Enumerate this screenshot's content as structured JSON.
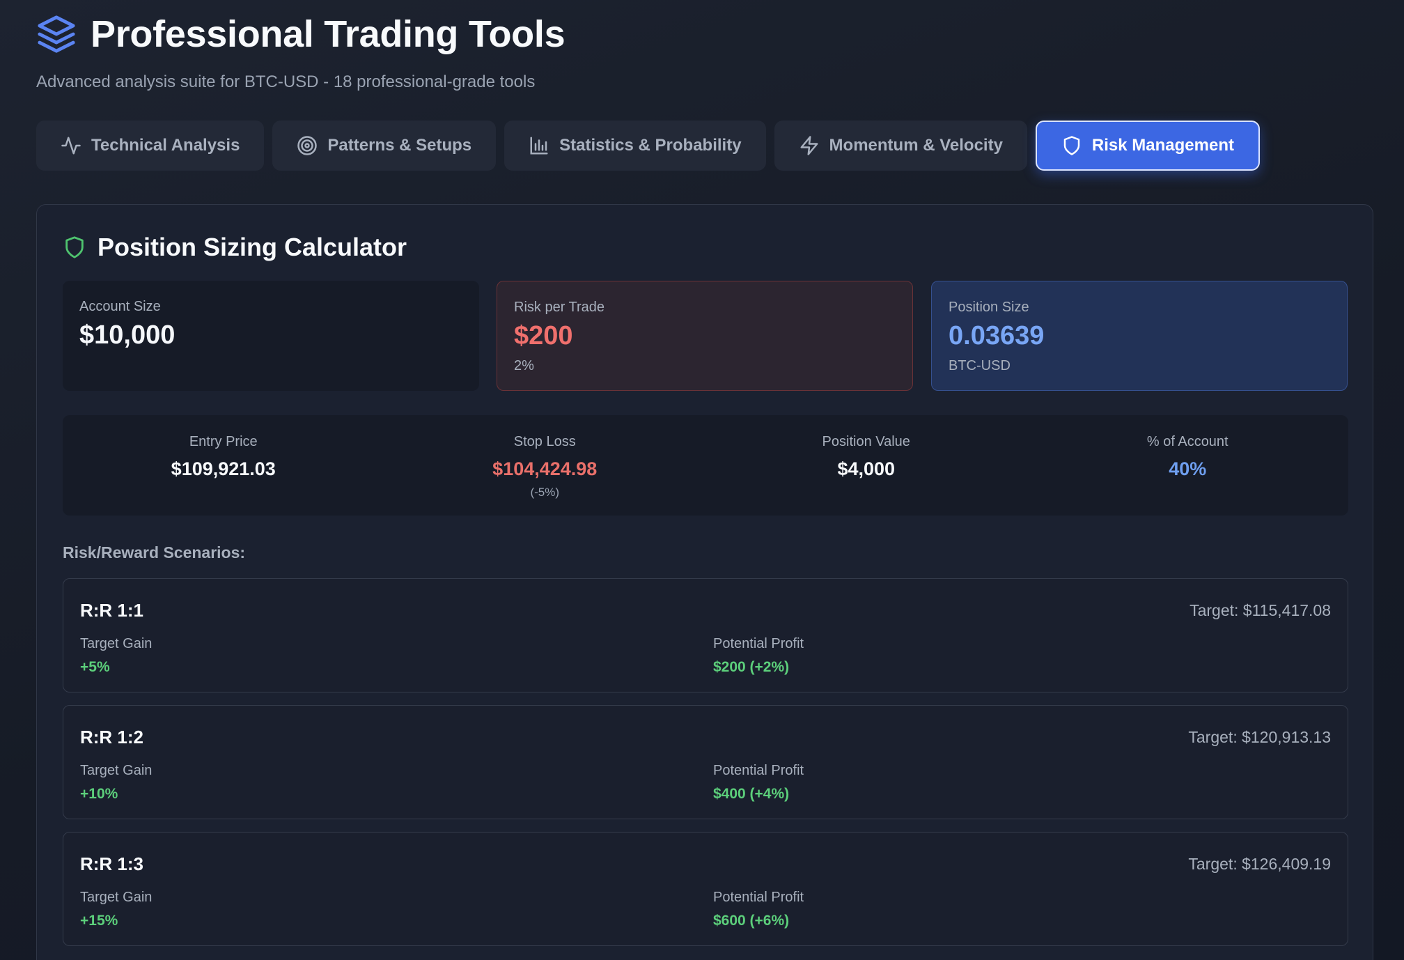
{
  "header": {
    "title": "Professional Trading Tools",
    "subtitle": "Advanced analysis suite for BTC-USD - 18 professional-grade tools",
    "icon": "layers-icon"
  },
  "tabs": [
    {
      "label": "Technical Analysis",
      "icon": "activity-icon",
      "active": false
    },
    {
      "label": "Patterns & Setups",
      "icon": "target-icon",
      "active": false
    },
    {
      "label": "Statistics & Probability",
      "icon": "bar-chart-icon",
      "active": false
    },
    {
      "label": "Momentum & Velocity",
      "icon": "lightning-icon",
      "active": false
    },
    {
      "label": "Risk Management",
      "icon": "shield-icon",
      "active": true
    }
  ],
  "panel": {
    "title": "Position Sizing Calculator",
    "icon": "shield-icon",
    "cards": {
      "account": {
        "label": "Account Size",
        "value": "$10,000"
      },
      "risk": {
        "label": "Risk per Trade",
        "value": "$200",
        "sub": "2%"
      },
      "position": {
        "label": "Position Size",
        "value": "0.03639",
        "sub": "BTC-USD"
      }
    },
    "metrics": {
      "entry": {
        "label": "Entry Price",
        "value": "$109,921.03"
      },
      "stop": {
        "label": "Stop Loss",
        "value": "$104,424.98",
        "note": "(-5%)"
      },
      "position_value": {
        "label": "Position Value",
        "value": "$4,000"
      },
      "pct_account": {
        "label": "% of Account",
        "value": "40%"
      }
    },
    "scenarios_label": "Risk/Reward Scenarios:",
    "scenarios": [
      {
        "rr": "R:R 1:1",
        "target": "Target: $115,417.08",
        "gain_label": "Target Gain",
        "gain": "+5%",
        "profit_label": "Potential Profit",
        "profit": "$200 (+2%)"
      },
      {
        "rr": "R:R 1:2",
        "target": "Target: $120,913.13",
        "gain_label": "Target Gain",
        "gain": "+10%",
        "profit_label": "Potential Profit",
        "profit": "$400 (+4%)"
      },
      {
        "rr": "R:R 1:3",
        "target": "Target: $126,409.19",
        "gain_label": "Target Gain",
        "gain": "+15%",
        "profit_label": "Potential Profit",
        "profit": "$600 (+6%)"
      }
    ]
  },
  "colors": {
    "accent": "#3c67e3",
    "loss": "#e9706a",
    "gain": "#5ccf7b",
    "info": "#6f9ff0",
    "shield": "#4fc46f"
  }
}
